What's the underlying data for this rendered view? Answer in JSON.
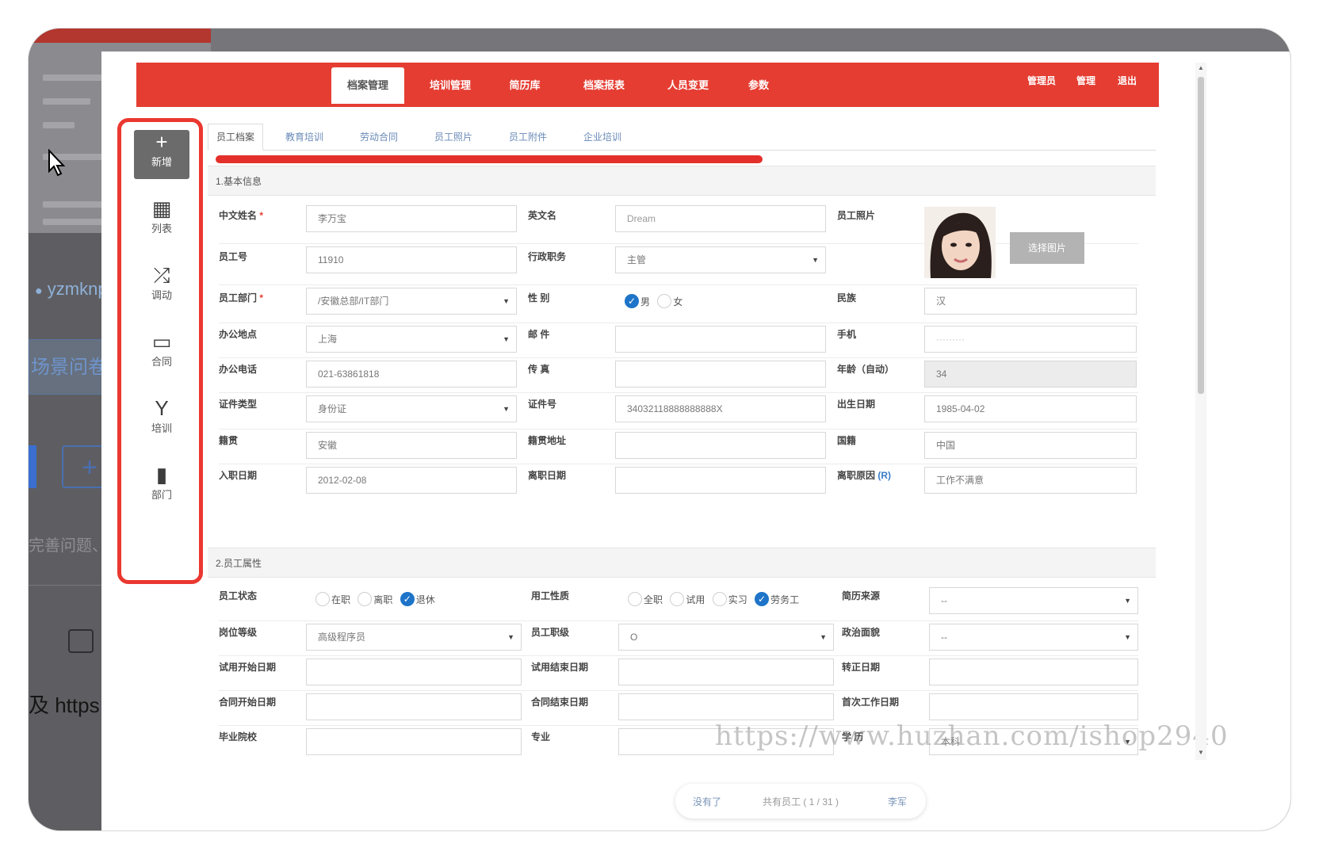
{
  "background": {
    "user_name": "yzmknp",
    "card_text": "场景问卷",
    "plus": "+",
    "desc_text": "完善问题、",
    "link_text": "及 https:/"
  },
  "nav": {
    "items": [
      "档案管理",
      "培训管理",
      "简历库",
      "档案报表",
      "人员变更",
      "参数"
    ],
    "right": [
      "管理员",
      "管理",
      "退出"
    ]
  },
  "sidebar": {
    "items": [
      {
        "icon": "+",
        "label": "新增"
      },
      {
        "icon": "▦",
        "label": "列表"
      },
      {
        "icon": "⤮",
        "label": "调动"
      },
      {
        "icon": "▭",
        "label": "合同"
      },
      {
        "icon": "Y",
        "label": "培训"
      },
      {
        "icon": "▮",
        "label": "部门"
      }
    ]
  },
  "tabs": [
    "员工档案",
    "教育培训",
    "劳动合同",
    "员工照片",
    "员工附件",
    "企业培训"
  ],
  "section1": {
    "title": "1.基本信息",
    "chinese_name": {
      "label": "中文姓名",
      "required": "*",
      "value": "李万宝"
    },
    "english_name": {
      "label": "英文名",
      "placeholder": "Dream"
    },
    "photo": {
      "label": "员工照片",
      "button": "选择图片"
    },
    "employee_no": {
      "label": "员工号",
      "value": "11910"
    },
    "admin_post": {
      "label": "行政职务",
      "value": "主管"
    },
    "department": {
      "label": "员工部门",
      "required": "*",
      "value": "/安徽总部/IT部门"
    },
    "gender": {
      "label": "性 别",
      "options": [
        "男",
        "女"
      ],
      "selected": "男"
    },
    "ethnicity": {
      "label": "民族",
      "value": "汉"
    },
    "office": {
      "label": "办公地点",
      "value": "上海"
    },
    "email": {
      "label": "邮 件",
      "value": ""
    },
    "mobile": {
      "label": "手机",
      "value": "·········"
    },
    "office_phone": {
      "label": "办公电话",
      "value": "021-63861818"
    },
    "fax": {
      "label": "传 真",
      "value": ""
    },
    "age": {
      "label": "年龄（自动）",
      "value": "34"
    },
    "id_type": {
      "label": "证件类型",
      "value": "身份证"
    },
    "id_no": {
      "label": "证件号",
      "value": "34032118888888888X"
    },
    "birth_date": {
      "label": "出生日期",
      "value": "1985-04-02"
    },
    "native_place": {
      "label": "籍贯",
      "value": "安徽"
    },
    "native_address": {
      "label": "籍贯地址",
      "value": ""
    },
    "nationality": {
      "label": "国籍",
      "value": "中国"
    },
    "join_date": {
      "label": "入职日期",
      "value": "2012-02-08"
    },
    "leave_date": {
      "label": "离职日期",
      "value": ""
    },
    "leave_reason": {
      "label": "离职原因",
      "tag": "(R)",
      "value": "工作不满意"
    }
  },
  "section2": {
    "title": "2.员工属性",
    "status": {
      "label": "员工状态",
      "options": [
        "在职",
        "离职",
        "退休"
      ],
      "selected": "退休"
    },
    "emp_type": {
      "label": "用工性质",
      "options": [
        "全职",
        "试用",
        "实习",
        "劳务工"
      ],
      "selected": "劳务工"
    },
    "resume_source": {
      "label": "简历来源",
      "value": "--"
    },
    "post_level": {
      "label": "岗位等级",
      "value": "高级程序员"
    },
    "title_level": {
      "label": "员工职级",
      "value": "O"
    },
    "political": {
      "label": "政治面貌",
      "value": "--"
    },
    "trial_start": {
      "label": "试用开始日期",
      "value": ""
    },
    "trial_end": {
      "label": "试用结束日期",
      "value": ""
    },
    "regular_date": {
      "label": "转正日期",
      "value": ""
    },
    "contract_start": {
      "label": "合同开始日期",
      "value": ""
    },
    "contract_end": {
      "label": "合同结束日期",
      "value": ""
    },
    "first_work": {
      "label": "首次工作日期",
      "value": ""
    },
    "school": {
      "label": "毕业院校",
      "value": ""
    },
    "major": {
      "label": "专业",
      "value": ""
    },
    "education": {
      "label": "学 历",
      "value": "本科"
    }
  },
  "watermark": "https://www.huzhan.com/ishop2940",
  "pager": {
    "prev": "没有了",
    "info": "共有员工 ( 1 / 31 )",
    "next": "李军"
  }
}
